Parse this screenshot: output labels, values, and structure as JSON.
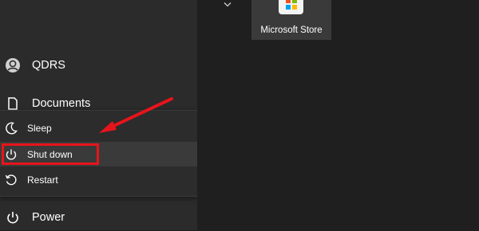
{
  "sidebar": {
    "user_label": "QDRS",
    "documents_label": "Documents",
    "power_label": "Power"
  },
  "power_menu": {
    "items": [
      {
        "label": "Sleep",
        "icon": "sleep-icon"
      },
      {
        "label": "Shut down",
        "icon": "power-icon"
      },
      {
        "label": "Restart",
        "icon": "restart-icon"
      }
    ]
  },
  "tile": {
    "label": "Microsoft Store",
    "icon": "microsoft-store-icon"
  },
  "colors": {
    "annotation": "#e8141b",
    "panel": "#2b2b2b",
    "background": "#1f1f1f"
  }
}
